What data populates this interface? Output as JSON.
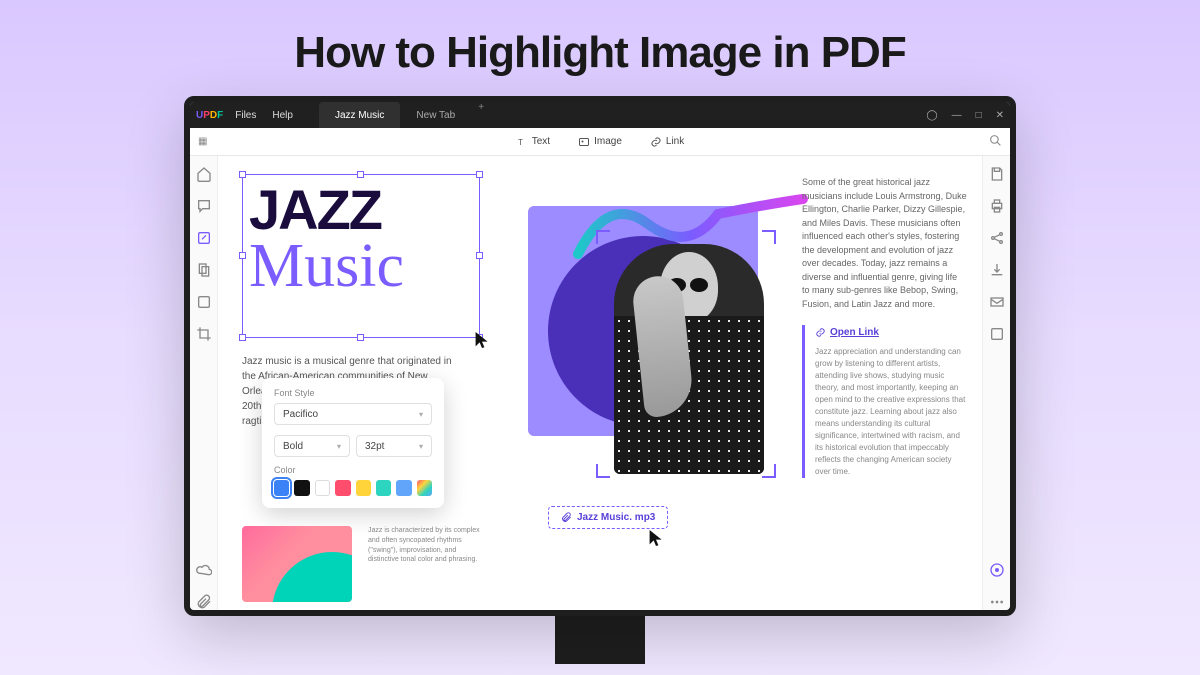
{
  "page_title": "How to Highlight Image in PDF",
  "logo_parts": {
    "u": "U",
    "p": "P",
    "d": "D",
    "f": "F"
  },
  "menu": {
    "files": "Files",
    "help": "Help"
  },
  "tabs": {
    "active": "Jazz Music",
    "inactive": "New Tab"
  },
  "toolbar": {
    "text": "Text",
    "image": "Image",
    "link": "Link"
  },
  "doc": {
    "jazz": "JAZZ",
    "music": "Music",
    "left_para": "Jazz music is a musical genre that originated in the African-American communities of New Orleans, Louisiana, in the late 19th and early 20th centuries, with its roots in blues and ragtime.",
    "mini_para": "Jazz is characterized by its complex and often syncopated rhythms (\"swing\"), improvisation, and distinctive tonal color and phrasing.",
    "right_para": "Some of the great historical jazz musicians include Louis Armstrong, Duke Ellington, Charlie Parker, Dizzy Gillespie, and Miles Davis. These musicians often influenced each other's styles, fostering the development and evolution of jazz over decades. Today, jazz remains a diverse and influential genre, giving life to many sub-genres like Bebop, Swing, Fusion, and Latin Jazz and more.",
    "open_link_label": "Open Link",
    "link_para": "Jazz appreciation and understanding can grow by listening to different artists, attending live shows, studying music theory, and most importantly, keeping an open mind to the creative expressions that constitute jazz. Learning about jazz also means understanding its cultural significance, intertwined with racism, and its historical evolution that impeccably reflects the changing American society over time.",
    "attachment": "Jazz Music. mp3"
  },
  "font_panel": {
    "style_label": "Font Style",
    "font_family": "Pacifico",
    "weight": "Bold",
    "size": "32pt",
    "color_label": "Color",
    "swatches": [
      "#3b82f6",
      "#111111",
      "#ffffff",
      "#ff4d6d",
      "#ffd43b",
      "#2dd4bf",
      "#60a5fa"
    ],
    "selected_swatch": 0,
    "gradient_swatch": true
  },
  "colors": {
    "accent": "#7b5cff"
  }
}
